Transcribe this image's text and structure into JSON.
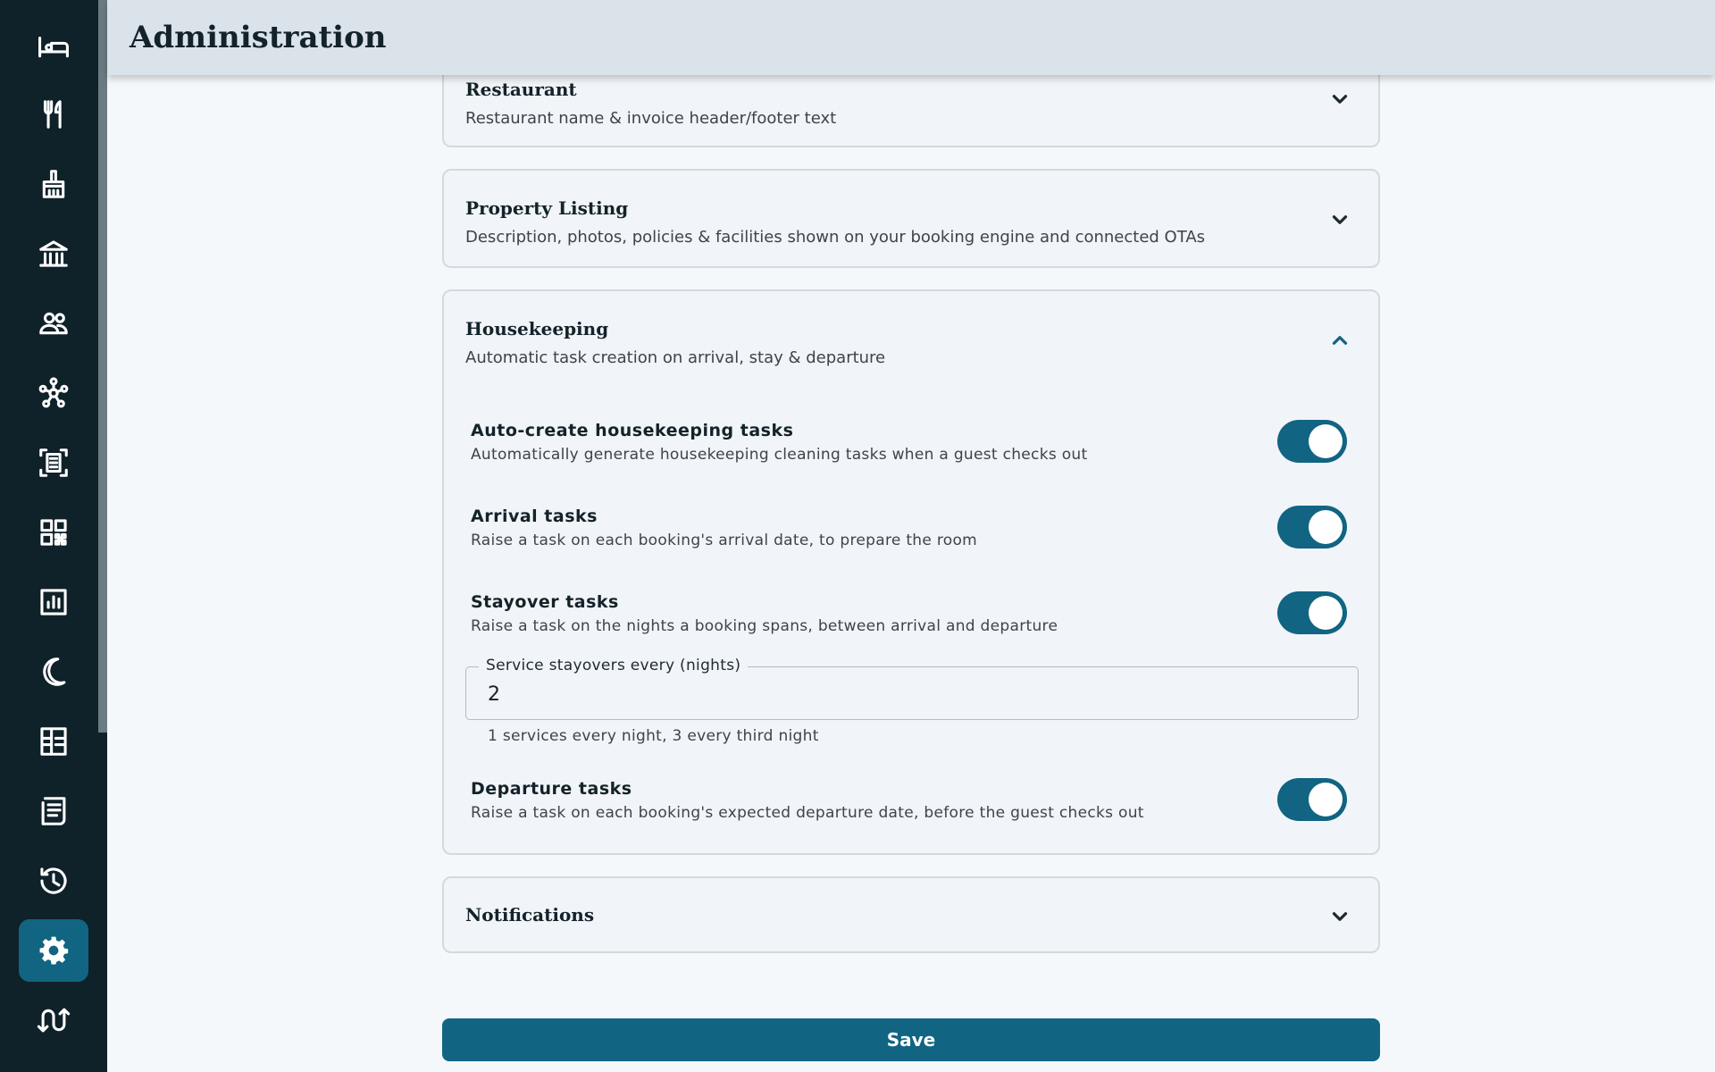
{
  "header": {
    "title": "Administration"
  },
  "sidebar": {
    "items": [
      {
        "icon": "bed-icon"
      },
      {
        "icon": "fork-knife-icon"
      },
      {
        "icon": "cleaning-brush-icon"
      },
      {
        "icon": "building-icon"
      },
      {
        "icon": "people-icon"
      },
      {
        "icon": "network-icon"
      },
      {
        "icon": "scan-document-icon"
      },
      {
        "icon": "qr-code-icon"
      },
      {
        "icon": "report-chart-icon"
      },
      {
        "icon": "moon-icon"
      },
      {
        "icon": "floor-plan-icon"
      },
      {
        "icon": "receipt-icon"
      },
      {
        "icon": "history-icon"
      },
      {
        "icon": "gear-icon",
        "active": true
      },
      {
        "icon": "channel-sync-icon"
      }
    ]
  },
  "sections": {
    "restaurant": {
      "title": "Restaurant",
      "subtitle": "Restaurant name & invoice header/footer text"
    },
    "property_listing": {
      "title": "Property Listing",
      "subtitle": "Description, photos, policies & facilities shown on your booking engine and connected OTAs"
    },
    "housekeeping": {
      "title": "Housekeeping",
      "subtitle": "Automatic task creation on arrival, stay & departure",
      "auto_create": {
        "title": "Auto-create housekeeping tasks",
        "desc": "Automatically generate housekeeping cleaning tasks when a guest checks out",
        "enabled": true
      },
      "arrival": {
        "title": "Arrival tasks",
        "desc": "Raise a task on each booking's arrival date, to prepare the room",
        "enabled": true
      },
      "stayover": {
        "title": "Stayover tasks",
        "desc": "Raise a task on the nights a booking spans, between arrival and departure",
        "enabled": true
      },
      "stayover_interval": {
        "label": "Service stayovers every (nights)",
        "value": "2",
        "helper": "1 services every night, 3 every third night"
      },
      "departure": {
        "title": "Departure tasks",
        "desc": "Raise a task on each booking's expected departure date, before the guest checks out",
        "enabled": true
      }
    },
    "notifications": {
      "title": "Notifications"
    }
  },
  "actions": {
    "save_label": "Save"
  },
  "colors": {
    "accent": "#116482",
    "sidebar_bg": "#0f2129",
    "header_bg": "#d9e3e9"
  }
}
